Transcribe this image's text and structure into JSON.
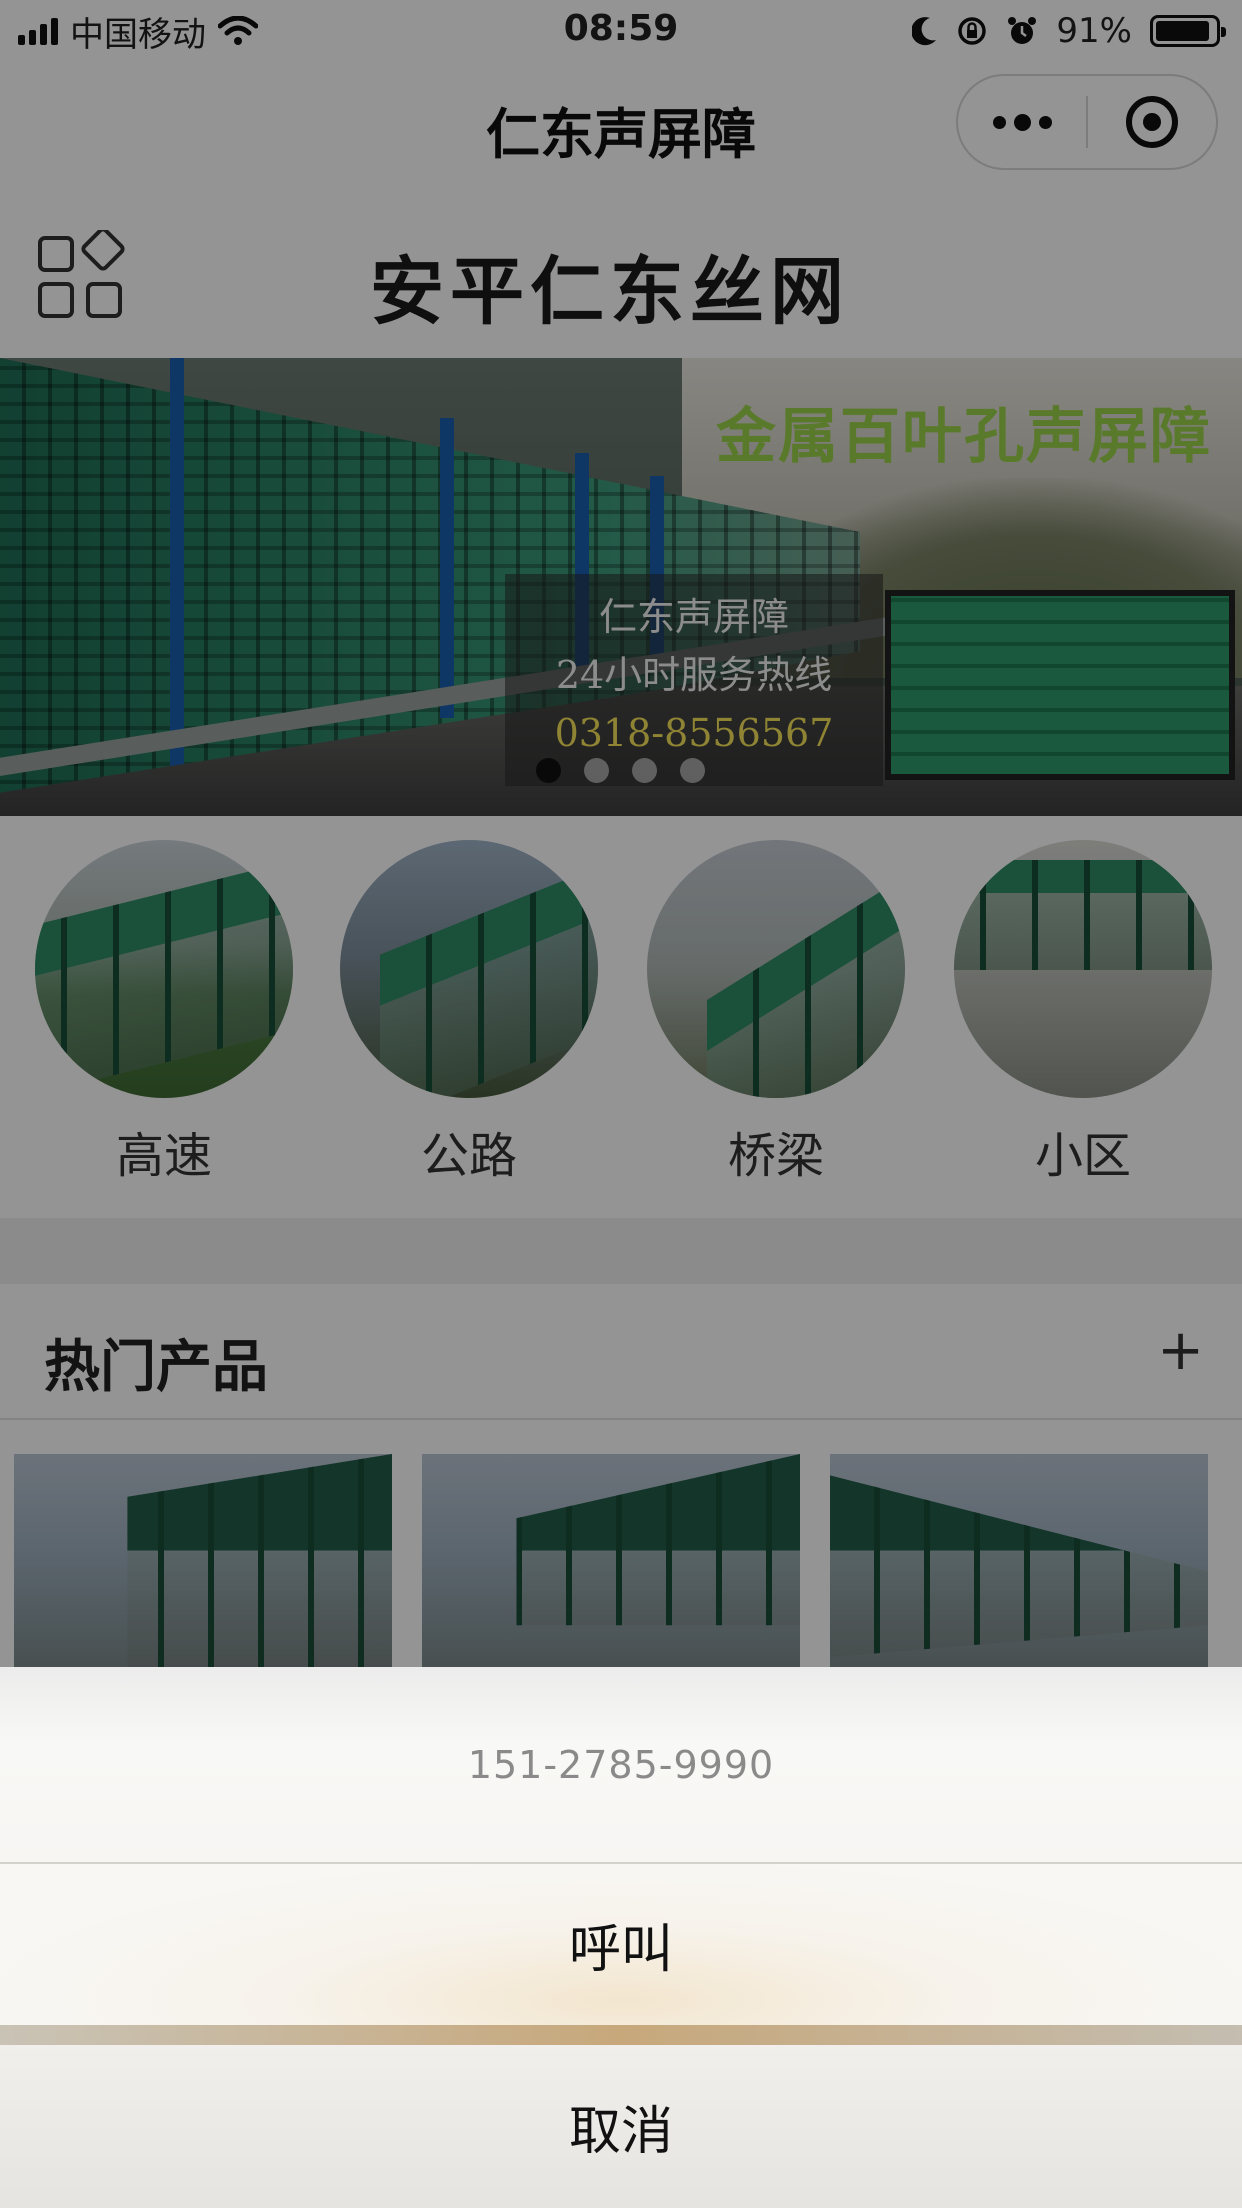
{
  "status_bar": {
    "carrier": "中国移动",
    "time": "08:59",
    "battery": "91%",
    "battery_level": 0.91
  },
  "nav": {
    "title": "仁东声屏障"
  },
  "header": {
    "logo_text": "安平仁东丝网"
  },
  "banner": {
    "headline": "金属百叶孔声屏障",
    "overlay_line1": "仁东声屏障",
    "overlay_line2": "24小时服务热线",
    "overlay_phone": "0318-8556567",
    "slide_count": 4,
    "active_slide": 1
  },
  "categories": [
    {
      "label": "高速"
    },
    {
      "label": "公路"
    },
    {
      "label": "桥梁"
    },
    {
      "label": "小区"
    }
  ],
  "hot_products": {
    "title": "热门产品",
    "more": "+"
  },
  "action_sheet": {
    "title": "151-2785-9990",
    "call_label": "呼叫",
    "cancel_label": "取消"
  },
  "icons": {
    "grid": "grid-menu-icon",
    "more": "more-dots-icon",
    "close": "capsule-close-icon",
    "wifi": "wifi-icon",
    "moon": "moon-icon",
    "rotation_lock": "rotation-lock-icon",
    "alarm": "alarm-icon"
  },
  "colors": {
    "banner_headline": "#9bd24a",
    "banner_phone": "#f4e35a",
    "mask": "rgba(0,0,0,0.42)"
  }
}
